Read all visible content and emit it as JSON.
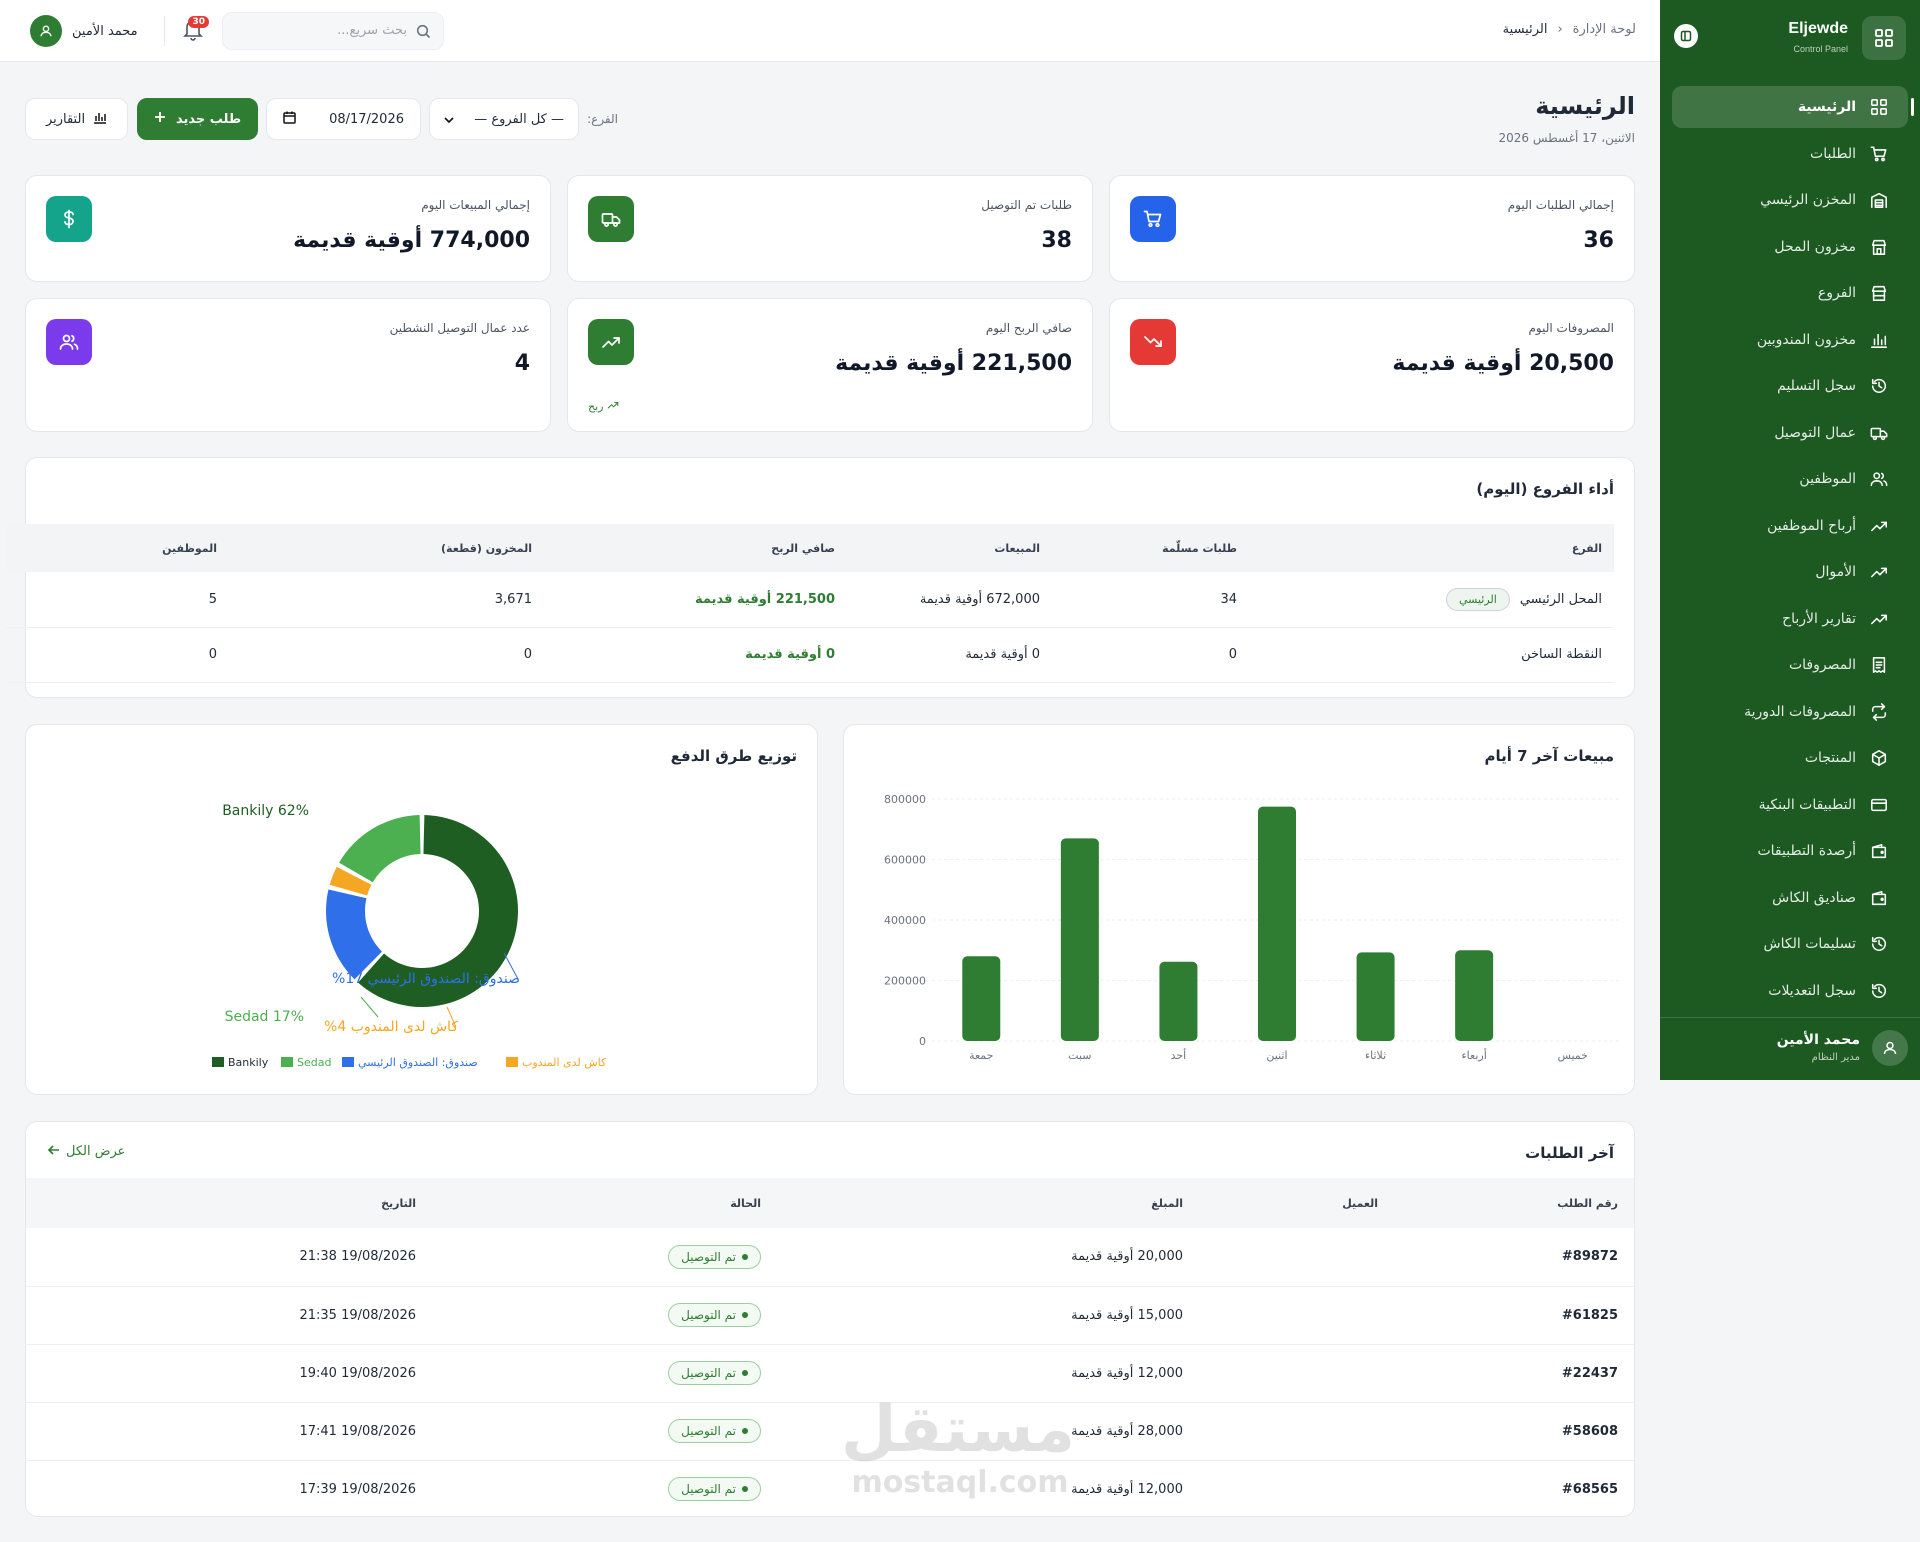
{
  "sidebar": {
    "brand_title": "Eljewde",
    "brand_sub": "Control Panel",
    "items": [
      {
        "label": "الرئيسية",
        "icon": "grid-icon",
        "active": true
      },
      {
        "label": "الطلبات",
        "icon": "cart-icon"
      },
      {
        "label": "المخزن الرئيسي",
        "icon": "warehouse-icon"
      },
      {
        "label": "مخزون المحل",
        "icon": "store-icon"
      },
      {
        "label": "الفروع",
        "icon": "branch-icon"
      },
      {
        "label": "مخزون المندوبين",
        "icon": "bar-chart-icon"
      },
      {
        "label": "سجل التسليم",
        "icon": "history-icon"
      },
      {
        "label": "عمال التوصيل",
        "icon": "truck-icon"
      },
      {
        "label": "الموظفين",
        "icon": "users-icon"
      },
      {
        "label": "أرباح الموظفين",
        "icon": "trend-up-icon"
      },
      {
        "label": "الأموال",
        "icon": "trend-up-icon"
      },
      {
        "label": "تقارير الأرباح",
        "icon": "trend-up-icon"
      },
      {
        "label": "المصروفات",
        "icon": "receipt-icon"
      },
      {
        "label": "المصروفات الدورية",
        "icon": "repeat-icon"
      },
      {
        "label": "المنتجات",
        "icon": "box-icon"
      },
      {
        "label": "التطبيقات البنكية",
        "icon": "card-icon"
      },
      {
        "label": "أرصدة التطبيقات",
        "icon": "wallet-icon"
      },
      {
        "label": "صناديق الكاش",
        "icon": "wallet-icon"
      },
      {
        "label": "تسليمات الكاش",
        "icon": "history-icon"
      },
      {
        "label": "سجل التعديلات",
        "icon": "history-icon"
      }
    ],
    "user_name": "محمد الأمين",
    "user_role": "مدير النظام"
  },
  "topbar": {
    "crumb_root": "لوحة الإدارة",
    "crumb_sep": "‹",
    "crumb_current": "الرئيسية",
    "search_placeholder": "بحث سريع...",
    "notif_count": "30",
    "user_name": "محمد الأمين"
  },
  "header": {
    "title": "الرئيسية",
    "date": "الاثنين، 17 أغسطس 2026",
    "branch_label": "الفرع:",
    "branch_value": "— كل الفروع —",
    "date_value": "08/17/2026",
    "new_order": "طلب جديد",
    "reports": "التقارير"
  },
  "stats": [
    {
      "label": "إجمالي الطلبات اليوم",
      "value": "36",
      "icon": "cart-icon",
      "color": "#2563eb"
    },
    {
      "label": "طلبات تم التوصيل",
      "value": "38",
      "icon": "truck-icon",
      "color": "#2e7d32"
    },
    {
      "label": "إجمالي المبيعات اليوم",
      "value": "774,000 أوقية قديمة",
      "icon": "dollar-icon",
      "color": "#14a38b"
    },
    {
      "label": "المصروفات اليوم",
      "value": "20,500 أوقية قديمة",
      "icon": "trend-down-icon",
      "color": "#e53935"
    },
    {
      "label": "صافي الربح اليوم",
      "value": "221,500 أوقية قديمة",
      "icon": "trend-up-icon",
      "color": "#2e7d32",
      "note": "ربح"
    },
    {
      "label": "عدد عمال التوصيل النشطين",
      "value": "4",
      "icon": "users-icon",
      "color": "#7c3aed"
    }
  ],
  "branches": {
    "title": "أداء الفروع (اليوم)",
    "headers": [
      "الفرع",
      "طلبات مسلّمة",
      "المبيعات",
      "صافي الربح",
      "المخزون (قطعة)",
      "الموظفين"
    ],
    "rows": [
      {
        "branch": "المحل الرئيسي",
        "tag": "الرئيسي",
        "orders": "34",
        "sales": "672,000 أوقية قديمة",
        "profit": "221,500 أوقية قديمة",
        "stock": "3,671",
        "staff": "5"
      },
      {
        "branch": "النقطة الساخن",
        "tag": "",
        "orders": "0",
        "sales": "0 أوقية قديمة",
        "profit": "0 أوقية قديمة",
        "stock": "0",
        "staff": "0"
      }
    ]
  },
  "chart_data": [
    {
      "type": "bar",
      "title": "مبيعات آخر 7 أيام",
      "categories": [
        "جمعة",
        "سبت",
        "أحد",
        "اثنين",
        "ثلاثاء",
        "أربعاء",
        "خميس"
      ],
      "values": [
        280000,
        670000,
        262000,
        775000,
        293000,
        300000,
        0
      ],
      "ylim": [
        0,
        800000
      ],
      "yticks": [
        0,
        200000,
        400000,
        600000,
        800000
      ],
      "grid": true,
      "color": "#2e7d32"
    },
    {
      "type": "pie",
      "title": "توزيع طرق الدفع",
      "donut": true,
      "slices": [
        {
          "name": "Bankily",
          "value": 62,
          "label": "Bankily 62%",
          "color": "#1f5e22"
        },
        {
          "name": "صندوق: الصندوق الرئيسي",
          "value": 17,
          "label": "صندوق: الصندوق الرئيسي 17%",
          "color": "#2f6fea"
        },
        {
          "name": "كاش لدى المندوب",
          "value": 4,
          "label": "كاش لدى المندوب 4%",
          "color": "#f5a623"
        },
        {
          "name": "Sedad",
          "value": 17,
          "label": "Sedad 17%",
          "color": "#4caf50"
        }
      ],
      "legend_position": "bottom"
    }
  ],
  "orders": {
    "title": "آخر الطلبات",
    "view_all": "عرض الكل",
    "headers": [
      "رقم الطلب",
      "العميل",
      "المبلغ",
      "الحالة",
      "التاريخ"
    ],
    "rows": [
      {
        "id": "#89872",
        "client": "",
        "amount": "20,000 أوقية قديمة",
        "status": "تم التوصيل",
        "date": "19/08/2026 21:38"
      },
      {
        "id": "#61825",
        "client": "",
        "amount": "15,000 أوقية قديمة",
        "status": "تم التوصيل",
        "date": "19/08/2026 21:35"
      },
      {
        "id": "#22437",
        "client": "",
        "amount": "12,000 أوقية قديمة",
        "status": "تم التوصيل",
        "date": "19/08/2026 19:40"
      },
      {
        "id": "#58608",
        "client": "",
        "amount": "28,000 أوقية قديمة",
        "status": "تم التوصيل",
        "date": "19/08/2026 17:41"
      },
      {
        "id": "#68565",
        "client": "",
        "amount": "12,000 أوقية قديمة",
        "status": "تم التوصيل",
        "date": "19/08/2026 17:39"
      }
    ]
  },
  "watermark": {
    "text_ar": "مستقل",
    "text_en": "mostaql.com"
  }
}
